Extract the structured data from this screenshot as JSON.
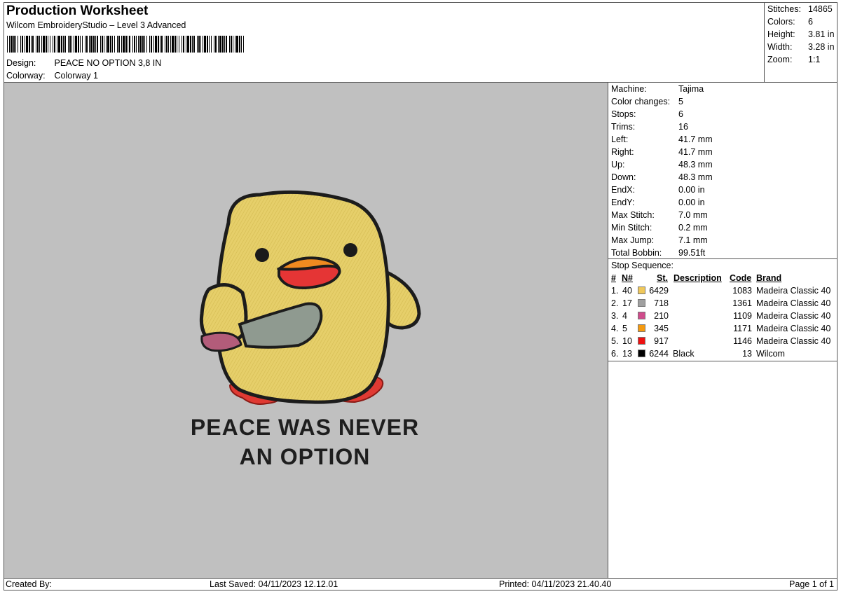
{
  "header": {
    "title": "Production Worksheet",
    "app": "Wilcom EmbroideryStudio – Level 3 Advanced",
    "design_label": "Design:",
    "design_value": "PEACE NO OPTION 3,8 IN",
    "colorway_label": "Colorway:",
    "colorway_value": "Colorway 1"
  },
  "summary": [
    {
      "label": "Stitches:",
      "value": "14865"
    },
    {
      "label": "Colors:",
      "value": "6"
    },
    {
      "label": "Height:",
      "value": "3.81 in"
    },
    {
      "label": "Width:",
      "value": "3.28 in"
    },
    {
      "label": "Zoom:",
      "value": "1:1"
    }
  ],
  "machine_info": [
    {
      "label": "Machine:",
      "value": "Tajima"
    },
    {
      "label": "Color changes:",
      "value": "5"
    },
    {
      "label": "Stops:",
      "value": "6"
    },
    {
      "label": "Trims:",
      "value": "16"
    },
    {
      "label": "Left:",
      "value": "41.7 mm"
    },
    {
      "label": "Right:",
      "value": "41.7 mm"
    },
    {
      "label": "Up:",
      "value": "48.3 mm"
    },
    {
      "label": "Down:",
      "value": "48.3 mm"
    },
    {
      "label": "EndX:",
      "value": "0.00 in"
    },
    {
      "label": "EndY:",
      "value": "0.00 in"
    },
    {
      "label": "Max Stitch:",
      "value": "7.0 mm"
    },
    {
      "label": "Min Stitch:",
      "value": "0.2 mm"
    },
    {
      "label": "Max Jump:",
      "value": "7.1 mm"
    },
    {
      "label": "Total Bobbin:",
      "value": "99.51ft"
    }
  ],
  "stop_sequence": {
    "title": "Stop Sequence:",
    "headers": {
      "num": "#",
      "n": "N#",
      "st": "St.",
      "desc": "Description",
      "code": "Code",
      "brand": "Brand"
    },
    "rows": [
      {
        "idx": "1.",
        "n": "40",
        "color": "#f0c85a",
        "st": "6429",
        "desc": "",
        "code": "1083",
        "brand": "Madeira Classic 40"
      },
      {
        "idx": "2.",
        "n": "17",
        "color": "#a0a0a0",
        "st": "718",
        "desc": "",
        "code": "1361",
        "brand": "Madeira Classic 40"
      },
      {
        "idx": "3.",
        "n": "4",
        "color": "#d04c8c",
        "st": "210",
        "desc": "",
        "code": "1109",
        "brand": "Madeira Classic 40"
      },
      {
        "idx": "4.",
        "n": "5",
        "color": "#f59a10",
        "st": "345",
        "desc": "",
        "code": "1171",
        "brand": "Madeira Classic 40"
      },
      {
        "idx": "5.",
        "n": "10",
        "color": "#ee1111",
        "st": "917",
        "desc": "",
        "code": "1146",
        "brand": "Madeira Classic 40"
      },
      {
        "idx": "6.",
        "n": "13",
        "color": "#000000",
        "st": "6244",
        "desc": "Black",
        "code": "13",
        "brand": "Wilcom"
      }
    ]
  },
  "design_text": {
    "line1": "PEACE WAS NEVER",
    "line2": "AN OPTION"
  },
  "footer": {
    "created_by": "Created By:",
    "last_saved": "Last Saved: 04/11/2023 12.12.01",
    "printed": "Printed: 04/11/2023 21.40.40",
    "page": "Page 1 of 1"
  }
}
